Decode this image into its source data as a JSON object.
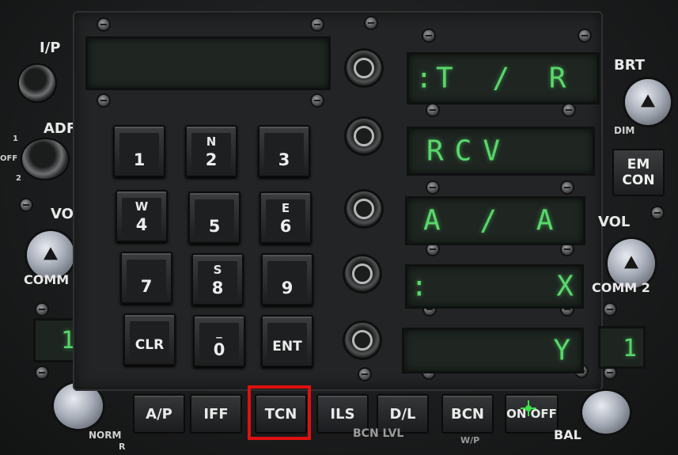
{
  "left_column": {
    "ip_label": "I/P",
    "adf_label": "ADF",
    "adf_positions": [
      "1",
      "OFF",
      "2"
    ],
    "vol_label": "VOL",
    "comm1_label": "COMM 1",
    "comm1_value": "1",
    "norm_label": "NORM",
    "r_label": "R"
  },
  "right_column": {
    "brt_label": "BRT",
    "dim_label": "DIM",
    "em_con_label_line1": "EM",
    "em_con_label_line2": "CON",
    "vol_label": "VOL",
    "comm2_label": "COMM 2",
    "comm2_value": "1",
    "bal_label": "BAL"
  },
  "scratchpad": {
    "value": ""
  },
  "option_displays": [
    {
      "cue": ":",
      "text": "T / R"
    },
    {
      "cue": "",
      "text": "RCV"
    },
    {
      "cue": "",
      "text": "A / A"
    },
    {
      "cue": ":",
      "text": "X"
    },
    {
      "cue": "",
      "text": "Y"
    }
  ],
  "keypad": [
    {
      "sub": "",
      "main": "1"
    },
    {
      "sub": "N",
      "main": "2"
    },
    {
      "sub": "",
      "main": "3"
    },
    {
      "sub": "W",
      "main": "4"
    },
    {
      "sub": "",
      "main": "5"
    },
    {
      "sub": "E",
      "main": "6"
    },
    {
      "sub": "",
      "main": "7"
    },
    {
      "sub": "S",
      "main": "8"
    },
    {
      "sub": "",
      "main": "9"
    },
    {
      "sub": "",
      "main": "CLR"
    },
    {
      "sub": "_",
      "main": "0"
    },
    {
      "sub": "",
      "main": "ENT"
    }
  ],
  "function_buttons": [
    "A/P",
    "IFF",
    "TCN",
    "ILS",
    "D/L",
    "BCN",
    "ON OFF"
  ],
  "highlighted_button": "TCN",
  "bottom_labels": {
    "bcn_lvl": "BCN LVL",
    "wpt": "W/P"
  },
  "colors": {
    "display_green": "#58d86a",
    "highlight_red": "#e01010",
    "panel": "#222425"
  }
}
